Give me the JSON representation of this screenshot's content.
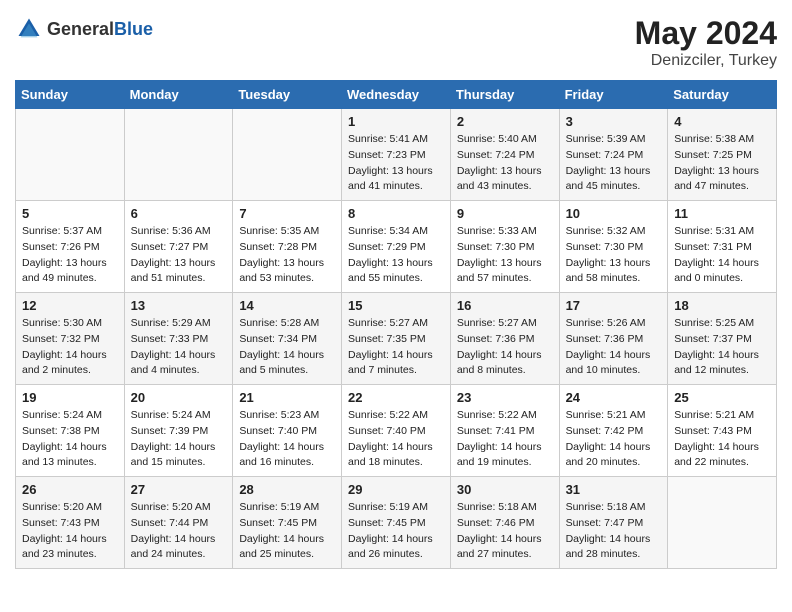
{
  "header": {
    "logo_general": "General",
    "logo_blue": "Blue",
    "title": "May 2024",
    "subtitle": "Denizciler, Turkey"
  },
  "calendar": {
    "days_of_week": [
      "Sunday",
      "Monday",
      "Tuesday",
      "Wednesday",
      "Thursday",
      "Friday",
      "Saturday"
    ],
    "weeks": [
      [
        {
          "day": "",
          "sunrise": "",
          "sunset": "",
          "daylight": ""
        },
        {
          "day": "",
          "sunrise": "",
          "sunset": "",
          "daylight": ""
        },
        {
          "day": "",
          "sunrise": "",
          "sunset": "",
          "daylight": ""
        },
        {
          "day": "1",
          "sunrise": "Sunrise: 5:41 AM",
          "sunset": "Sunset: 7:23 PM",
          "daylight": "Daylight: 13 hours and 41 minutes."
        },
        {
          "day": "2",
          "sunrise": "Sunrise: 5:40 AM",
          "sunset": "Sunset: 7:24 PM",
          "daylight": "Daylight: 13 hours and 43 minutes."
        },
        {
          "day": "3",
          "sunrise": "Sunrise: 5:39 AM",
          "sunset": "Sunset: 7:24 PM",
          "daylight": "Daylight: 13 hours and 45 minutes."
        },
        {
          "day": "4",
          "sunrise": "Sunrise: 5:38 AM",
          "sunset": "Sunset: 7:25 PM",
          "daylight": "Daylight: 13 hours and 47 minutes."
        }
      ],
      [
        {
          "day": "5",
          "sunrise": "Sunrise: 5:37 AM",
          "sunset": "Sunset: 7:26 PM",
          "daylight": "Daylight: 13 hours and 49 minutes."
        },
        {
          "day": "6",
          "sunrise": "Sunrise: 5:36 AM",
          "sunset": "Sunset: 7:27 PM",
          "daylight": "Daylight: 13 hours and 51 minutes."
        },
        {
          "day": "7",
          "sunrise": "Sunrise: 5:35 AM",
          "sunset": "Sunset: 7:28 PM",
          "daylight": "Daylight: 13 hours and 53 minutes."
        },
        {
          "day": "8",
          "sunrise": "Sunrise: 5:34 AM",
          "sunset": "Sunset: 7:29 PM",
          "daylight": "Daylight: 13 hours and 55 minutes."
        },
        {
          "day": "9",
          "sunrise": "Sunrise: 5:33 AM",
          "sunset": "Sunset: 7:30 PM",
          "daylight": "Daylight: 13 hours and 57 minutes."
        },
        {
          "day": "10",
          "sunrise": "Sunrise: 5:32 AM",
          "sunset": "Sunset: 7:30 PM",
          "daylight": "Daylight: 13 hours and 58 minutes."
        },
        {
          "day": "11",
          "sunrise": "Sunrise: 5:31 AM",
          "sunset": "Sunset: 7:31 PM",
          "daylight": "Daylight: 14 hours and 0 minutes."
        }
      ],
      [
        {
          "day": "12",
          "sunrise": "Sunrise: 5:30 AM",
          "sunset": "Sunset: 7:32 PM",
          "daylight": "Daylight: 14 hours and 2 minutes."
        },
        {
          "day": "13",
          "sunrise": "Sunrise: 5:29 AM",
          "sunset": "Sunset: 7:33 PM",
          "daylight": "Daylight: 14 hours and 4 minutes."
        },
        {
          "day": "14",
          "sunrise": "Sunrise: 5:28 AM",
          "sunset": "Sunset: 7:34 PM",
          "daylight": "Daylight: 14 hours and 5 minutes."
        },
        {
          "day": "15",
          "sunrise": "Sunrise: 5:27 AM",
          "sunset": "Sunset: 7:35 PM",
          "daylight": "Daylight: 14 hours and 7 minutes."
        },
        {
          "day": "16",
          "sunrise": "Sunrise: 5:27 AM",
          "sunset": "Sunset: 7:36 PM",
          "daylight": "Daylight: 14 hours and 8 minutes."
        },
        {
          "day": "17",
          "sunrise": "Sunrise: 5:26 AM",
          "sunset": "Sunset: 7:36 PM",
          "daylight": "Daylight: 14 hours and 10 minutes."
        },
        {
          "day": "18",
          "sunrise": "Sunrise: 5:25 AM",
          "sunset": "Sunset: 7:37 PM",
          "daylight": "Daylight: 14 hours and 12 minutes."
        }
      ],
      [
        {
          "day": "19",
          "sunrise": "Sunrise: 5:24 AM",
          "sunset": "Sunset: 7:38 PM",
          "daylight": "Daylight: 14 hours and 13 minutes."
        },
        {
          "day": "20",
          "sunrise": "Sunrise: 5:24 AM",
          "sunset": "Sunset: 7:39 PM",
          "daylight": "Daylight: 14 hours and 15 minutes."
        },
        {
          "day": "21",
          "sunrise": "Sunrise: 5:23 AM",
          "sunset": "Sunset: 7:40 PM",
          "daylight": "Daylight: 14 hours and 16 minutes."
        },
        {
          "day": "22",
          "sunrise": "Sunrise: 5:22 AM",
          "sunset": "Sunset: 7:40 PM",
          "daylight": "Daylight: 14 hours and 18 minutes."
        },
        {
          "day": "23",
          "sunrise": "Sunrise: 5:22 AM",
          "sunset": "Sunset: 7:41 PM",
          "daylight": "Daylight: 14 hours and 19 minutes."
        },
        {
          "day": "24",
          "sunrise": "Sunrise: 5:21 AM",
          "sunset": "Sunset: 7:42 PM",
          "daylight": "Daylight: 14 hours and 20 minutes."
        },
        {
          "day": "25",
          "sunrise": "Sunrise: 5:21 AM",
          "sunset": "Sunset: 7:43 PM",
          "daylight": "Daylight: 14 hours and 22 minutes."
        }
      ],
      [
        {
          "day": "26",
          "sunrise": "Sunrise: 5:20 AM",
          "sunset": "Sunset: 7:43 PM",
          "daylight": "Daylight: 14 hours and 23 minutes."
        },
        {
          "day": "27",
          "sunrise": "Sunrise: 5:20 AM",
          "sunset": "Sunset: 7:44 PM",
          "daylight": "Daylight: 14 hours and 24 minutes."
        },
        {
          "day": "28",
          "sunrise": "Sunrise: 5:19 AM",
          "sunset": "Sunset: 7:45 PM",
          "daylight": "Daylight: 14 hours and 25 minutes."
        },
        {
          "day": "29",
          "sunrise": "Sunrise: 5:19 AM",
          "sunset": "Sunset: 7:45 PM",
          "daylight": "Daylight: 14 hours and 26 minutes."
        },
        {
          "day": "30",
          "sunrise": "Sunrise: 5:18 AM",
          "sunset": "Sunset: 7:46 PM",
          "daylight": "Daylight: 14 hours and 27 minutes."
        },
        {
          "day": "31",
          "sunrise": "Sunrise: 5:18 AM",
          "sunset": "Sunset: 7:47 PM",
          "daylight": "Daylight: 14 hours and 28 minutes."
        },
        {
          "day": "",
          "sunrise": "",
          "sunset": "",
          "daylight": ""
        }
      ]
    ]
  }
}
